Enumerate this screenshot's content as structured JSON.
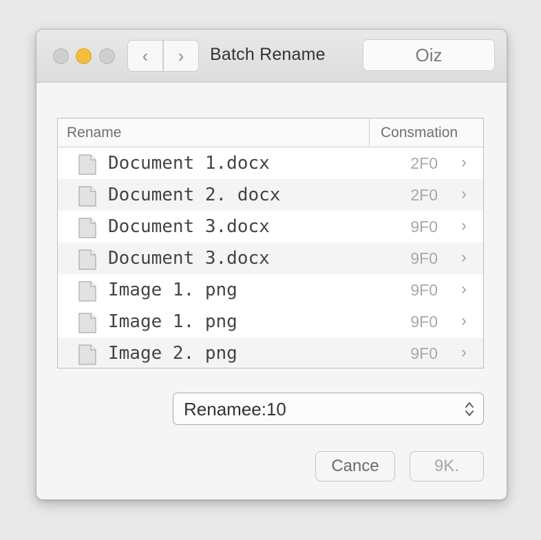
{
  "window": {
    "title": "Batch Rename",
    "search_text": "Oiz"
  },
  "table": {
    "headers": [
      "Rename",
      "Consmation"
    ],
    "rows": [
      {
        "name": "Document 1.docx",
        "value": "2F0",
        "alt": false
      },
      {
        "name": "Document 2. docx",
        "value": "2F0",
        "alt": true
      },
      {
        "name": "Document 3.docx",
        "value": "9F0",
        "alt": false
      },
      {
        "name": "Document 3.docx",
        "value": "9F0",
        "alt": true
      },
      {
        "name": "Image 1. png",
        "value": "9F0",
        "alt": false
      },
      {
        "name": "Image 1. png",
        "value": "9F0",
        "alt": false
      },
      {
        "name": "Image 2. png",
        "value": "9F0",
        "alt": true
      }
    ]
  },
  "select": {
    "value": "Renamee:10"
  },
  "buttons": {
    "cancel": "Cance",
    "ok": "9K."
  },
  "icons": {
    "back": "chevron-left-icon",
    "forward": "chevron-right-icon",
    "row_chevron": "chevron-right-icon",
    "file": "document-icon",
    "select_arrows": "up-down-arrows-icon"
  },
  "colors": {
    "minimize_light": "#f4bd3b",
    "traffic_inactive": "#cfcfcf"
  }
}
